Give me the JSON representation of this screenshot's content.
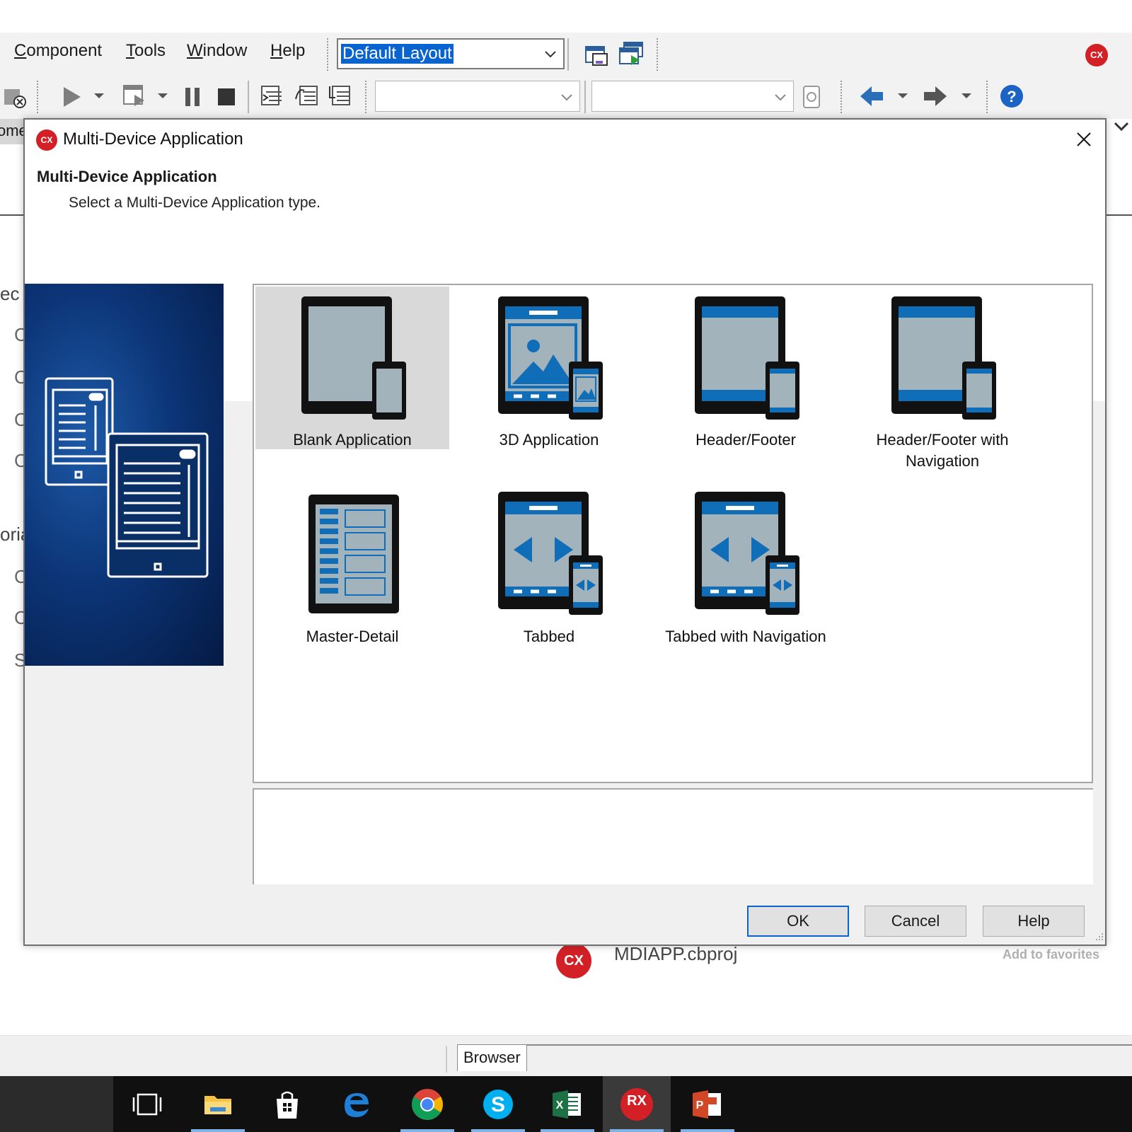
{
  "menubar": {
    "items": [
      {
        "mnemonic": "C",
        "rest": "omponent"
      },
      {
        "mnemonic": "T",
        "rest": "ools"
      },
      {
        "mnemonic": "W",
        "rest": "indow"
      },
      {
        "mnemonic": "H",
        "rest": "elp"
      }
    ],
    "layout_combo_value": "Default Layout"
  },
  "ide": {
    "left_tab_fragment": "ome",
    "left_fragments": [
      "ec",
      "C",
      "C",
      "C",
      "C",
      "oria",
      "C",
      "C",
      "S"
    ],
    "status_tab": "Browser",
    "recent_file": {
      "name": "MDIAPP.cbproj",
      "action": "Add to favorites",
      "badge": "CX"
    },
    "app_badge": "CX"
  },
  "dialog": {
    "title": "Multi-Device Application",
    "heading": "Multi-Device Application",
    "subheading": "Select a Multi-Device Application type.",
    "title_badge": "CX",
    "templates": [
      {
        "label": "Blank Application",
        "icon": "blank-app-icon",
        "selected": true
      },
      {
        "label": "3D Application",
        "icon": "3d-app-icon",
        "selected": false
      },
      {
        "label": "Header/Footer",
        "icon": "header-footer-icon",
        "selected": false
      },
      {
        "label": "Header/Footer with Navigation",
        "icon": "header-footer-nav-icon",
        "selected": false
      },
      {
        "label": "Master-Detail",
        "icon": "master-detail-icon",
        "selected": false
      },
      {
        "label": "Tabbed",
        "icon": "tabbed-icon",
        "selected": false
      },
      {
        "label": "Tabbed with Navigation",
        "icon": "tabbed-nav-icon",
        "selected": false
      }
    ],
    "description": "",
    "buttons": {
      "ok": "OK",
      "cancel": "Cancel",
      "help": "Help"
    }
  },
  "taskbar": {
    "apps": [
      {
        "name": "task-view",
        "active": false
      },
      {
        "name": "file-explorer",
        "active": false
      },
      {
        "name": "store",
        "active": false
      },
      {
        "name": "edge",
        "active": false
      },
      {
        "name": "chrome",
        "active": false
      },
      {
        "name": "skype",
        "active": false
      },
      {
        "name": "excel",
        "active": false
      },
      {
        "name": "rad-studio",
        "active": true
      },
      {
        "name": "powerpoint",
        "active": false
      }
    ],
    "rad_label": "RX"
  },
  "colors": {
    "accent": "#0a64d0",
    "device_blue": "#0f6eb7",
    "device_screen": "#a3b3bb",
    "brand_red": "#d32026"
  }
}
